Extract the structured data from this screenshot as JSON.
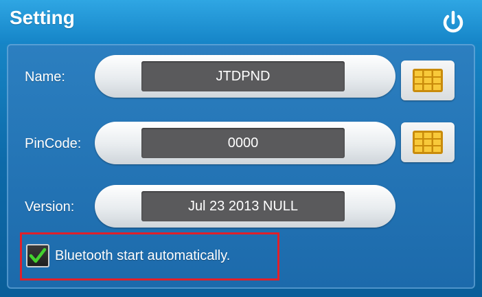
{
  "header": {
    "title": "Setting",
    "power_icon": "power-icon"
  },
  "fields": [
    {
      "label": "Name:",
      "value": "JTDPND",
      "has_keypad": true,
      "keypad_icon": "keypad-icon"
    },
    {
      "label": "PinCode:",
      "value": "0000",
      "has_keypad": true,
      "keypad_icon": "keypad-icon"
    },
    {
      "label": "Version:",
      "value": "Jul 23 2013 NULL",
      "has_keypad": false
    }
  ],
  "options": {
    "bluetooth_auto": {
      "label": "Bluetooth start automatically.",
      "checked": true,
      "check_icon": "checkmark-icon"
    }
  },
  "colors": {
    "background": "#0d6aa9",
    "header": "#1584c7",
    "value_box": "#5a5a5c",
    "keypad_accent": "#f2b21c",
    "checkmark": "#43d12f",
    "highlight": "#e0202a"
  }
}
